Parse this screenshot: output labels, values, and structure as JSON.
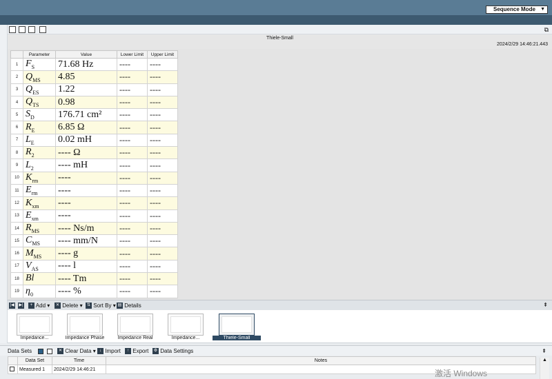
{
  "header": {
    "sequence_mode": "Sequence Mode"
  },
  "panel": {
    "title": "Thiele-Small",
    "timestamp": "2024/2/29 14:46:21.443"
  },
  "table": {
    "columns": [
      "Parameter",
      "Value",
      "Lower Limit",
      "Upper Limit"
    ],
    "rows": [
      {
        "num": "1",
        "sym": "F",
        "sub": "S",
        "value": "71.68 Hz",
        "lower": "----",
        "upper": "----"
      },
      {
        "num": "2",
        "sym": "Q",
        "sub": "MS",
        "value": "4.85",
        "lower": "----",
        "upper": "----"
      },
      {
        "num": "3",
        "sym": "Q",
        "sub": "ES",
        "value": "1.22",
        "lower": "----",
        "upper": "----"
      },
      {
        "num": "4",
        "sym": "Q",
        "sub": "TS",
        "value": "0.98",
        "lower": "----",
        "upper": "----"
      },
      {
        "num": "5",
        "sym": "S",
        "sub": "D",
        "value": "176.71 cm²",
        "lower": "----",
        "upper": "----"
      },
      {
        "num": "6",
        "sym": "R",
        "sub": "E",
        "value": "6.85 Ω",
        "lower": "----",
        "upper": "----"
      },
      {
        "num": "7",
        "sym": "L",
        "sub": "E",
        "value": "0.02 mH",
        "lower": "----",
        "upper": "----"
      },
      {
        "num": "8",
        "sym": "R",
        "sub": "2",
        "value": "---- Ω",
        "lower": "----",
        "upper": "----"
      },
      {
        "num": "9",
        "sym": "L",
        "sub": "2",
        "value": "---- mH",
        "lower": "----",
        "upper": "----"
      },
      {
        "num": "10",
        "sym": "K",
        "sub": "rm",
        "value": "----",
        "lower": "----",
        "upper": "----"
      },
      {
        "num": "11",
        "sym": "E",
        "sub": "rm",
        "value": "----",
        "lower": "----",
        "upper": "----"
      },
      {
        "num": "12",
        "sym": "K",
        "sub": "xm",
        "value": "----",
        "lower": "----",
        "upper": "----"
      },
      {
        "num": "13",
        "sym": "E",
        "sub": "xm",
        "value": "----",
        "lower": "----",
        "upper": "----"
      },
      {
        "num": "14",
        "sym": "R",
        "sub": "MS",
        "value": "---- Ns/m",
        "lower": "----",
        "upper": "----"
      },
      {
        "num": "15",
        "sym": "C",
        "sub": "MS",
        "value": "---- mm/N",
        "lower": "----",
        "upper": "----"
      },
      {
        "num": "16",
        "sym": "M",
        "sub": "MS",
        "value": "---- g",
        "lower": "----",
        "upper": "----"
      },
      {
        "num": "17",
        "sym": "V",
        "sub": "AS",
        "value": "---- l",
        "lower": "----",
        "upper": "----"
      },
      {
        "num": "18",
        "sym": "Bl",
        "sub": "",
        "value": "---- Tm",
        "lower": "----",
        "upper": "----"
      },
      {
        "num": "19",
        "sym": "η",
        "sub": "0",
        "value": "---- %",
        "lower": "----",
        "upper": "----"
      }
    ]
  },
  "nav": {
    "add": "Add",
    "delete": "Delete",
    "sort_by": "Sort By",
    "details": "Details"
  },
  "thumbnails": [
    {
      "label": "Impedance..."
    },
    {
      "label": "Impedance Phase"
    },
    {
      "label": "Impedance Real"
    },
    {
      "label": "Impedance..."
    },
    {
      "label": "Thiele-Small"
    }
  ],
  "datasets": {
    "label": "Data Sets",
    "clear": "Clear Data",
    "import": "Import",
    "export": "Export",
    "settings": "Data Settings",
    "columns": [
      "Data Set",
      "Time",
      "Notes"
    ],
    "row": {
      "name": "Measured 1",
      "time": "2024/2/29 14:46:21",
      "notes": ""
    }
  },
  "watermark": "激活 Windows"
}
